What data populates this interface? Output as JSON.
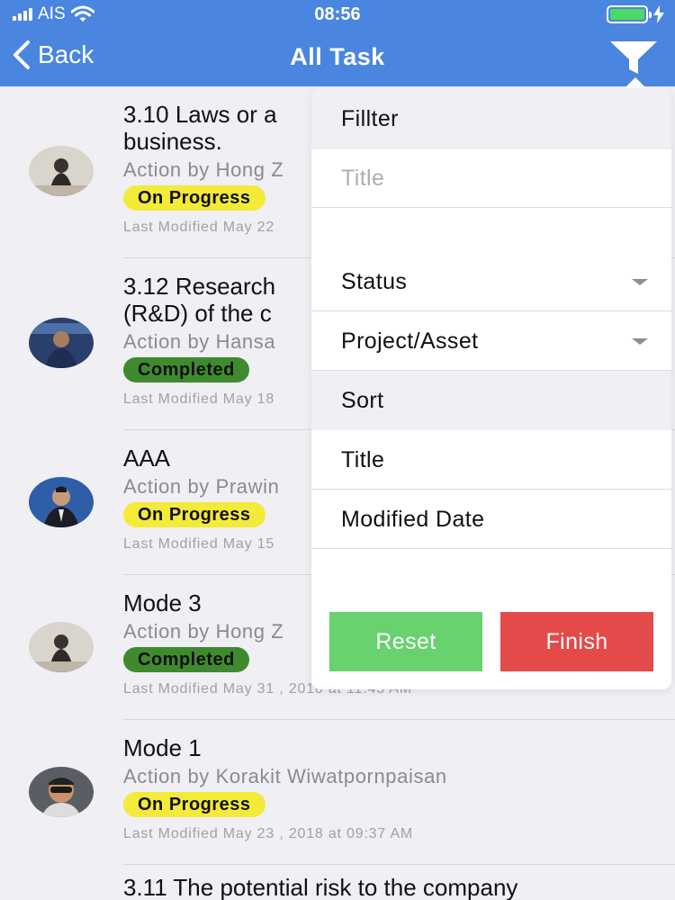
{
  "status_bar": {
    "carrier": "AIS",
    "time": "08:56"
  },
  "nav": {
    "back_label": "Back",
    "title": "All Task"
  },
  "tasks": [
    {
      "title_line1": "3.10 Laws or a",
      "title_line2": "business.",
      "action": "Action by Hong Z",
      "status": "On Progress",
      "modified": "Last Modified May 22"
    },
    {
      "title_line1": "3.12 Research",
      "title_line2": "(R&D) of the c",
      "action": "Action by Hansa",
      "status": "Completed",
      "modified": "Last Modified May 18"
    },
    {
      "title_line1": "AAA",
      "action": "Action by Prawin",
      "status": "On Progress",
      "modified": "Last Modified May 15"
    },
    {
      "title_line1": "Mode 3",
      "action": "Action by Hong Z",
      "status": "Completed",
      "modified": "Last Modified May 31 , 2018 at 11:43 AM"
    },
    {
      "title_line1": "Mode 1",
      "action": "Action by Korakit Wiwatpornpaisan",
      "status": "On Progress",
      "modified": "Last Modified May 23 , 2018 at 09:37 AM"
    },
    {
      "title_line1": "3.11 The potential risk to the company"
    }
  ],
  "filter_panel": {
    "header": "Fillter",
    "title_placeholder": "Title",
    "status_label": "Status",
    "project_label": "Project/Asset",
    "sort_header": "Sort",
    "sort_title": "Title",
    "sort_modified": "Modified Date",
    "reset_label": "Reset",
    "finish_label": "Finish"
  },
  "colors": {
    "nav_blue": "#4a86e0",
    "on_progress": "#f3ea3a",
    "completed": "#3f8a2e",
    "reset_green": "#67d26e",
    "finish_red": "#e34a4a"
  }
}
